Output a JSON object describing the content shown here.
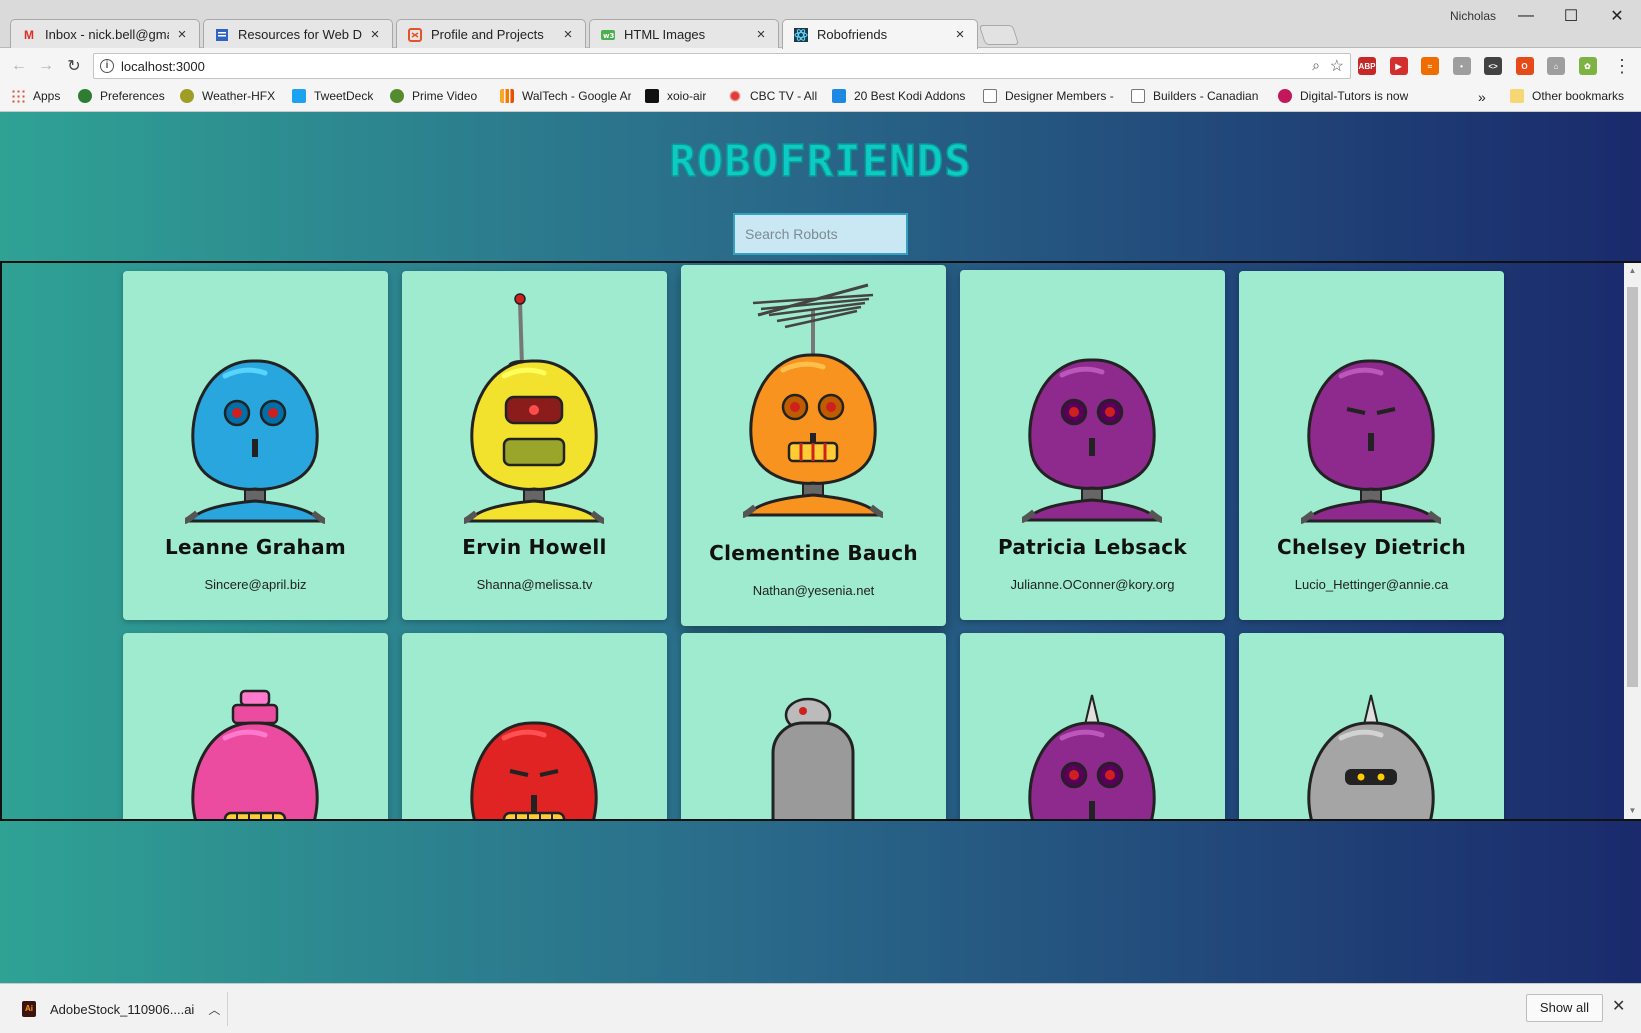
{
  "browser": {
    "profile_name": "Nicholas",
    "tabs": [
      {
        "title": "Inbox - nick.bell@gmail.c",
        "icon": "gmail-icon",
        "color": "#d93025"
      },
      {
        "title": "Resources for Web Devel",
        "icon": "doc-icon",
        "color": "#2f63c4"
      },
      {
        "title": "Profile and Projects",
        "icon": "codepen-icon",
        "color": "#e3542b"
      },
      {
        "title": "HTML Images",
        "icon": "w3schools-icon",
        "color": "#4caf50"
      },
      {
        "title": "Robofriends",
        "icon": "react-icon",
        "color": "#1c3a4e"
      }
    ],
    "url": "localhost:3000",
    "bookmarks": [
      {
        "label": "Apps",
        "color": "#e0503a"
      },
      {
        "label": "Preferences",
        "color": "#2e7d32"
      },
      {
        "label": "Weather-HFX",
        "color": "#9e9d24"
      },
      {
        "label": "TweetDeck",
        "color": "#1da1f2"
      },
      {
        "label": "Prime Video",
        "color": "#558b2f"
      },
      {
        "label": "WalTech - Google Ar",
        "color": "#f9a825"
      },
      {
        "label": "xoio-air",
        "color": "#111111"
      },
      {
        "label": "CBC TV - All",
        "color": "#e53935"
      },
      {
        "label": "20 Best Kodi Addons",
        "color": "#1e88e5"
      },
      {
        "label": "Designer Members -",
        "color": "#888888"
      },
      {
        "label": "Builders - Canadian",
        "color": "#888888"
      },
      {
        "label": "Digital-Tutors is now",
        "color": "#c2185b"
      }
    ],
    "bookmarks_overflow": "»",
    "other_bookmarks": "Other bookmarks",
    "extensions": [
      {
        "name": "adblock-icon",
        "label": "ABP",
        "color": "#c62828"
      },
      {
        "name": "video-ext-icon",
        "label": "▶",
        "color": "#d32f2f"
      },
      {
        "name": "rss-ext-icon",
        "label": "≈",
        "color": "#ef6c00"
      },
      {
        "name": "pin-ext-icon",
        "label": "•",
        "color": "#9e9e9e"
      },
      {
        "name": "code-ext-icon",
        "label": "<>",
        "color": "#424242"
      },
      {
        "name": "office-ext-icon",
        "label": "O",
        "color": "#e64a19"
      },
      {
        "name": "people-ext-icon",
        "label": "⌂",
        "color": "#9e9e9e"
      },
      {
        "name": "color-ext-icon",
        "label": "✿",
        "color": "#7cb342"
      }
    ]
  },
  "page": {
    "title": "RoboFriends",
    "search_placeholder": "Search Robots"
  },
  "robots": [
    {
      "name": "Leanne Graham",
      "email": "Sincere@april.biz",
      "color": "#2aa6de",
      "antenna": "none",
      "eyes": "red"
    },
    {
      "name": "Ervin Howell",
      "email": "Shanna@melissa.tv",
      "color": "#f2e22e",
      "antenna": "spike-ball",
      "eyes": "single"
    },
    {
      "name": "Clementine Bauch",
      "email": "Nathan@yesenia.net",
      "color": "#f7931e",
      "antenna": "tv",
      "eyes": "red"
    },
    {
      "name": "Patricia Lebsack",
      "email": "Julianne.OConner@kory.org",
      "color": "#8e2a8e",
      "antenna": "none",
      "eyes": "red"
    },
    {
      "name": "Chelsey Dietrich",
      "email": "Lucio_Hettinger@annie.ca",
      "color": "#8e2a8e",
      "antenna": "none",
      "eyes": "slit"
    },
    {
      "name": "",
      "email": "",
      "color": "#ec4ca0",
      "antenna": "cap",
      "eyes": "none"
    },
    {
      "name": "",
      "email": "",
      "color": "#e02424",
      "antenna": "none",
      "eyes": "slit"
    },
    {
      "name": "",
      "email": "",
      "color": "#9a9a9a",
      "antenna": "dish",
      "eyes": "none"
    },
    {
      "name": "",
      "email": "",
      "color": "#8e2a8e",
      "antenna": "horn",
      "eyes": "red"
    },
    {
      "name": "",
      "email": "",
      "color": "#a5a5a5",
      "antenna": "horn",
      "eyes": "visor"
    }
  ],
  "downloads": {
    "file_name": "AdobeStock_110906....ai",
    "show_all": "Show all"
  }
}
